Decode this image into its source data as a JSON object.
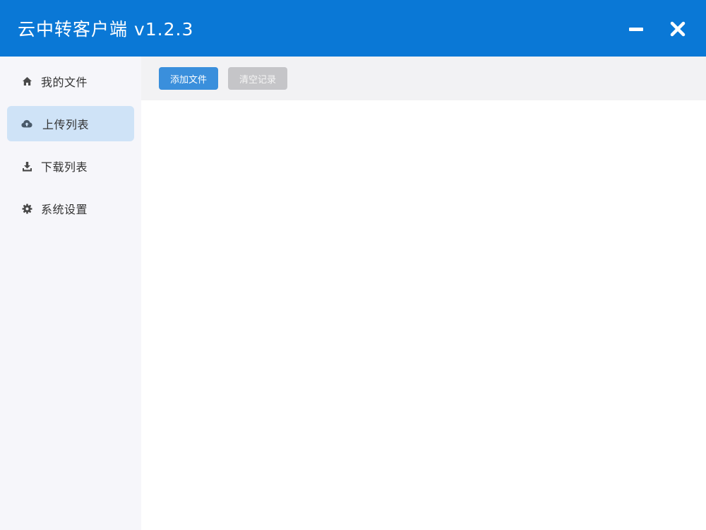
{
  "titlebar": {
    "title": "云中转客户端 v1.2.3",
    "minimize_icon": "minimize-icon",
    "close_icon": "close-icon",
    "background": "#0a78d6"
  },
  "sidebar": {
    "items": [
      {
        "label": "我的文件",
        "icon": "home-icon",
        "active": false
      },
      {
        "label": "上传列表",
        "icon": "cloud-upload-icon",
        "active": true
      },
      {
        "label": "下载列表",
        "icon": "download-icon",
        "active": false
      },
      {
        "label": "系统设置",
        "icon": "gear-icon",
        "active": false
      }
    ]
  },
  "toolbar": {
    "add_file_label": "添加文件",
    "clear_records_label": "清空记录"
  },
  "colors": {
    "accent": "#3a8fdc",
    "active_nav": "#cfe3f7",
    "disabled_button": "#c5c5c8"
  }
}
